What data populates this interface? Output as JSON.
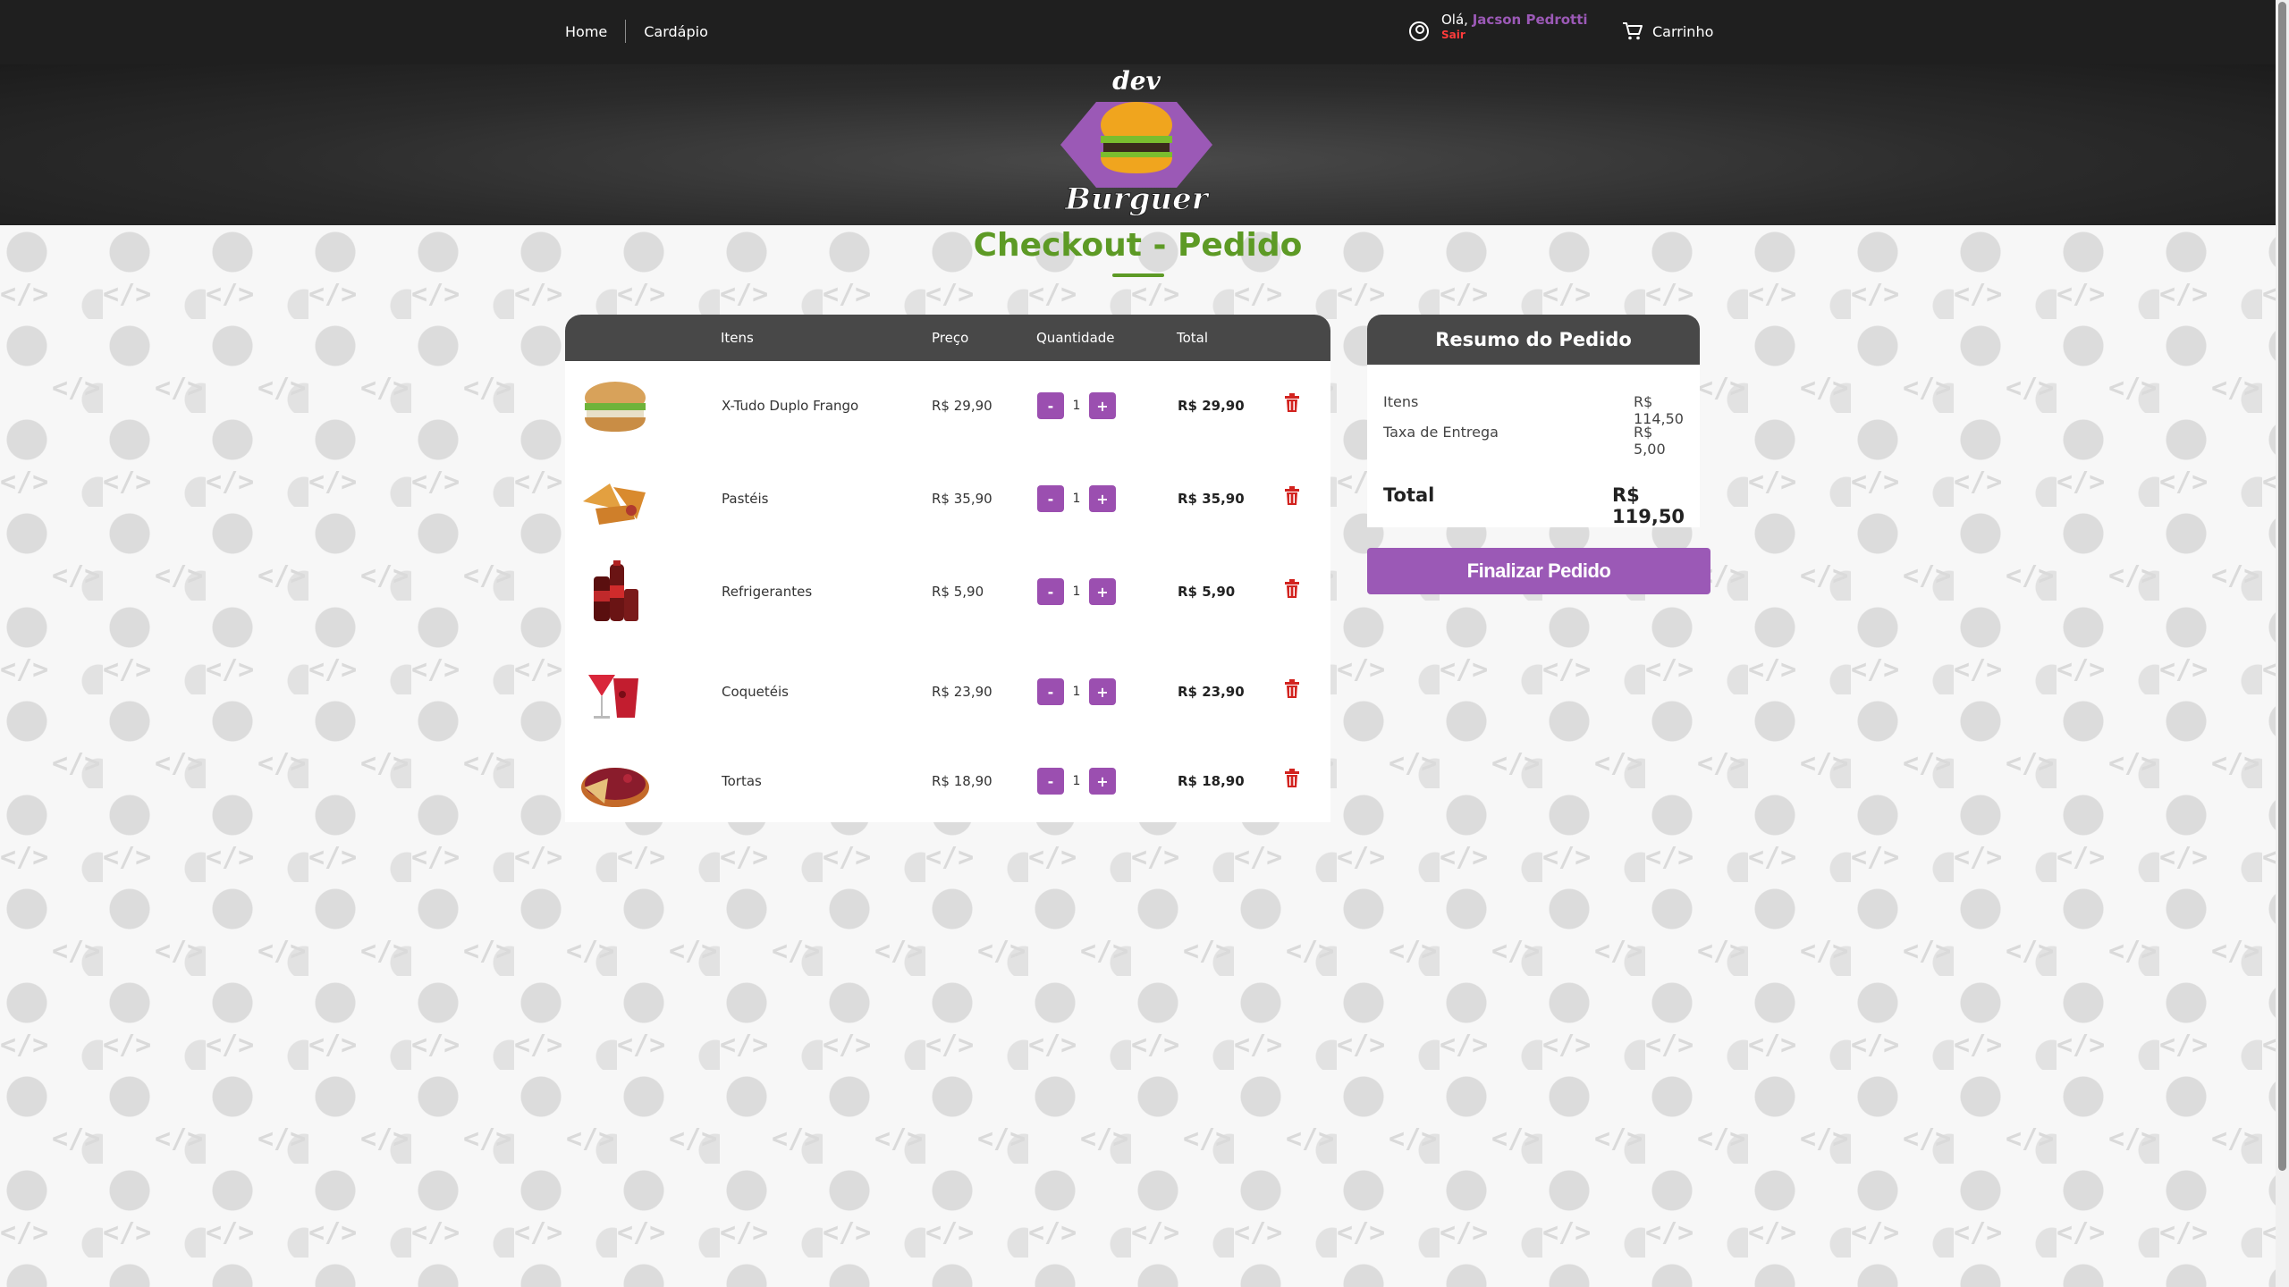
{
  "nav": {
    "home": "Home",
    "menu": "Cardápio",
    "greeting": "Olá,",
    "user_name": "Jacson Pedrotti",
    "logout": "Sair",
    "cart": "Carrinho"
  },
  "logo": {
    "line1": "dev",
    "line2": "Burguer"
  },
  "page_title": "Checkout - Pedido",
  "table": {
    "headers": {
      "items": "Itens",
      "price": "Preço",
      "quantity": "Quantidade",
      "total": "Total"
    },
    "rows": [
      {
        "name": "X-Tudo Duplo Frango",
        "price": "R$ 29,90",
        "qty": "1",
        "total": "R$ 29,90",
        "image": "burger"
      },
      {
        "name": "Pastéis",
        "price": "R$ 35,90",
        "qty": "1",
        "total": "R$ 35,90",
        "image": "pastel"
      },
      {
        "name": "Refrigerantes",
        "price": "R$ 5,90",
        "qty": "1",
        "total": "R$ 5,90",
        "image": "soda"
      },
      {
        "name": "Coquetéis",
        "price": "R$ 23,90",
        "qty": "1",
        "total": "R$ 23,90",
        "image": "cocktail"
      },
      {
        "name": "Tortas",
        "price": "R$ 18,90",
        "qty": "1",
        "total": "R$ 18,90",
        "image": "pie"
      }
    ],
    "minus": "-",
    "plus": "+"
  },
  "summary": {
    "title": "Resumo do Pedido",
    "items_label": "Itens",
    "items_value": "R$ 114,50",
    "delivery_label": "Taxa de Entrega",
    "delivery_value": "R$ 5,00",
    "total_label": "Total",
    "total_value": "R$ 119,50"
  },
  "finish_button": "Finalizar Pedido",
  "colors": {
    "accent": "#9b59b6",
    "title_green": "#5d9a25",
    "logout_red": "#ff3b3b",
    "header_dark": "#1f1f1f"
  }
}
